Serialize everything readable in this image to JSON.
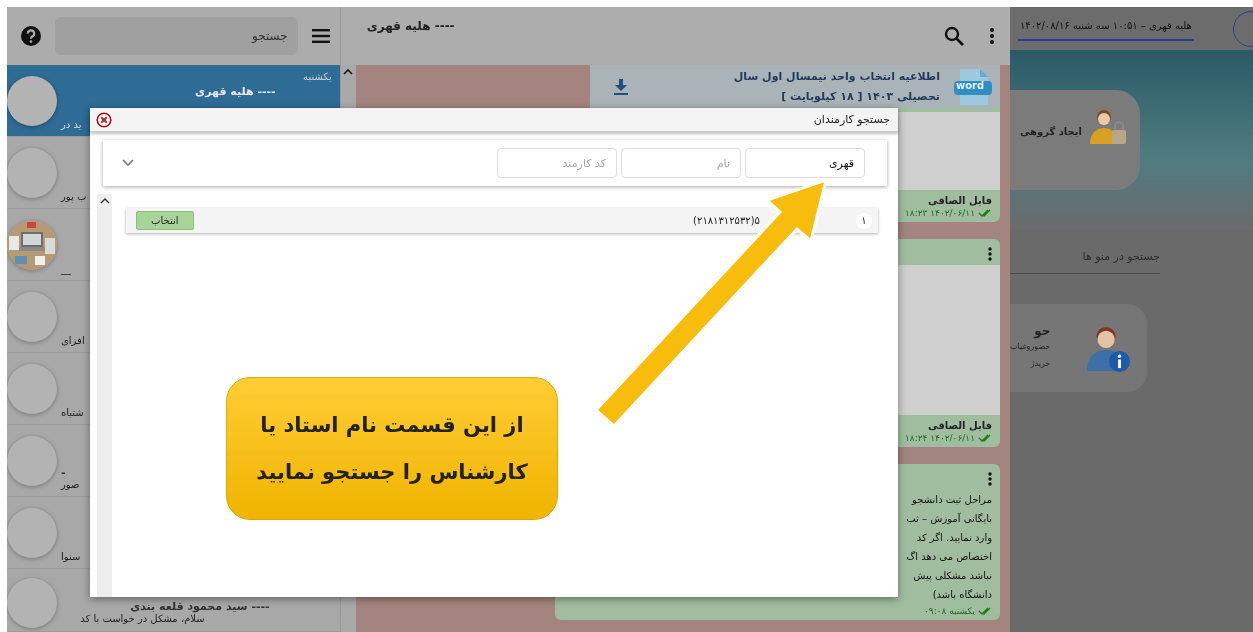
{
  "chat_list": {
    "search": {
      "placeholder": "جستجو"
    },
    "items": [
      {
        "selected": true,
        "kind": "blank",
        "day": "یکشنبه",
        "name": "هلیه قهری ----",
        "preview": "ید در"
      },
      {
        "selected": false,
        "kind": "blank",
        "preview": "ب پور"
      },
      {
        "selected": false,
        "kind": "picture",
        "preview": "__"
      },
      {
        "selected": false,
        "kind": "blank",
        "preview": "افزای"
      },
      {
        "selected": false,
        "kind": "blank",
        "preview": "شتباه"
      },
      {
        "selected": false,
        "kind": "blank",
        "name": "-",
        "preview": "صور"
      },
      {
        "selected": false,
        "kind": "blank",
        "preview": "سنوا"
      },
      {
        "selected": false,
        "kind": "blank",
        "name": "سید محمود قلعه بندی ----",
        "preview": "سلام، مشکل در خواست با کد"
      }
    ]
  },
  "chat": {
    "title": "---- هلیه قهری",
    "attachment": {
      "title": "اطلاعیه انتخاب واحد نیمسال اول سال تحصیلی ۱۴۰۳ [ ۱۸ کیلوبایت ]",
      "file_type": "word"
    },
    "messages": [
      {
        "kind": "file",
        "menu": false,
        "caption": "فایل الصاقی",
        "timestamp": "۱۴۰۲/۰۶/۱۱ ۱۸:۲۳"
      },
      {
        "kind": "file",
        "menu": true,
        "caption": "فایل الصاقی",
        "timestamp": "۱۴۰۲/۰۶/۱۱ ۱۸:۲۴"
      },
      {
        "kind": "text",
        "menu": true,
        "lines": [
          "مراحل ثبت دانشجو",
          "بایگانی آموزش – ثب",
          "وارد نمایید. اگر کد",
          "اختصاص می دهد اگ",
          "نباشد مشکلی پیش",
          "دانشگاه باشد)"
        ],
        "timestamp": "یکشنبه ۰۹:۰۸"
      }
    ]
  },
  "right_panel": {
    "user_line": "هلیه قهری – ۱۰:۵۱ سه شنبه ۱۴۰۲/۰۸/۱۶",
    "group_card": {
      "title": "ایجاد گروهی"
    },
    "menu_search": {
      "placeholder": "جستجو در منو ها"
    },
    "info_card": {
      "title": "حو",
      "lines": [
        "حضوروغیاب",
        "خریدژ"
      ]
    }
  },
  "dialog": {
    "title": "جستجو کارمندان",
    "filters": [
      {
        "value": "قهری"
      },
      {
        "placeholder": "نام"
      },
      {
        "placeholder": "کد کارمند"
      }
    ],
    "results": [
      {
        "index": "۱",
        "text": "(۲۱۸۱۳۱۲۵۳۲)۵",
        "action": "انتخاب"
      }
    ]
  },
  "callout": {
    "text": "از این قسمت نام استاد یا کارشناس را جستجو نمایید"
  }
}
